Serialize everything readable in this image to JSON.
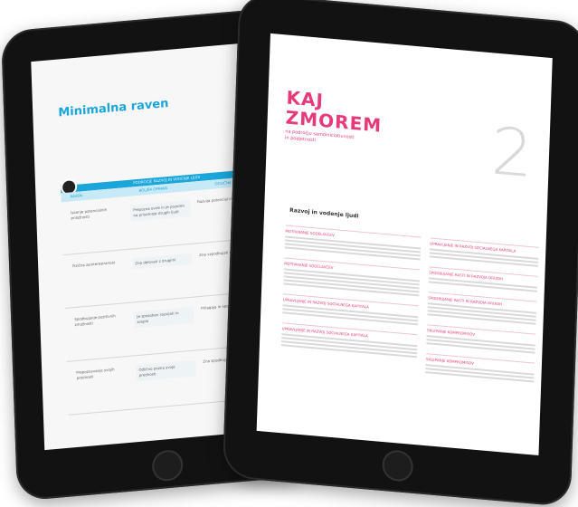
{
  "left_screen": {
    "title": "Minimalna raven",
    "table_subheading": "PODROČJE RAZVOJ IN VODENJE LJUDI",
    "columns": [
      "RAVEN",
      "BOLJŠA OPRAVA",
      "ODLIČNA RAVEN"
    ],
    "rows": [
      {
        "c1": "Iskanje potencialnih priložnosti",
        "c2": "Prepozna ovire in je pozoren na prisotnost drugih ljudi",
        "c3": "Razvija potencial in pomoč drugim"
      },
      {
        "c1": "Fizična zainteresiranost",
        "c2": "Zna delovati z drugimi",
        "c3": "Zna vzpodbujati in razvijati druge"
      },
      {
        "c1": "Spodbujanje pozitivnih zmožnosti",
        "c2": "Je sposoben razvijati in krepiti",
        "c3": "Prilagaja in spodbuja"
      },
      {
        "c1": "Prepoznavanje svojih prednosti",
        "c2": "Odlično pozna svoje prednosti",
        "c3": "Zna spodbujati"
      }
    ]
  },
  "right_screen": {
    "title_line1": "KAJ",
    "title_line2": "ZMOREM",
    "subtitle": "na področju samoiniciativnosti in podjetnosti",
    "chapter_number": "2",
    "section_title": "Razvoj in vodenje ljudi",
    "left_blocks": [
      "MOTIVIRANJE SODELAVCEV",
      "MOTIVIRANJE SODELAVCEV",
      "UPRAVLJANJE IN RAZVOJ SOCIALNEGA KAPITALA",
      "UPRAVLJANJE IN RAZVOJ SOCIALNEGA KAPITALA"
    ],
    "right_blocks": [
      "UPRAVLJANJE IN RAZVOJ SOCIALNEGA KAPITALA",
      "SPODBUJANJE RASTI IN RAZVOJA DRUGIH",
      "SPODBUJANJE RASTI IN RAZVOJA DRUGIH",
      "SKLEPANJE KOMPROMISOV",
      "SKLEPANJE KOMPROMISOV"
    ]
  }
}
